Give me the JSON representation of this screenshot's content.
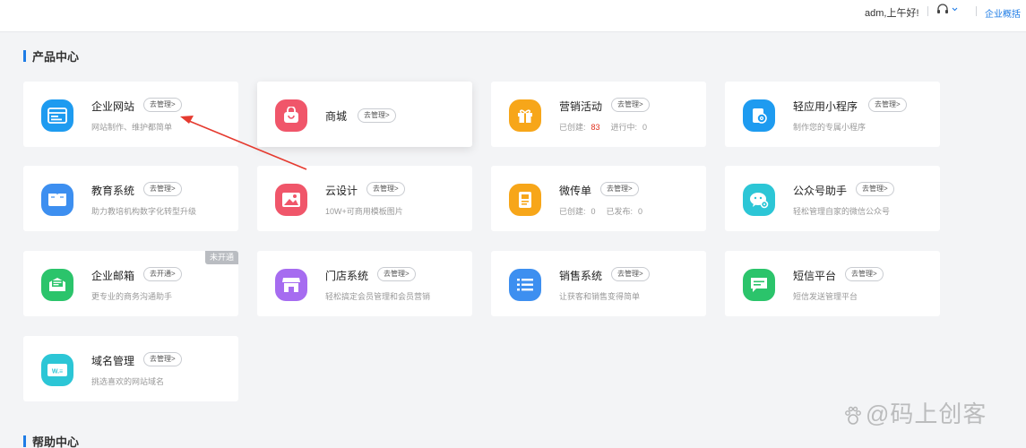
{
  "header": {
    "greeting": "adm,上午好!",
    "nav_link": "企业概括"
  },
  "sections": {
    "product_center": "产品中心",
    "help_center": "帮助中心"
  },
  "products": [
    {
      "name": "企业网站",
      "action": "去管理>",
      "desc": "网站制作、维护都简单",
      "icon": "browser-window-icon",
      "color": "#1e9bf0"
    },
    {
      "name": "商城",
      "action": "去管理>",
      "desc": "",
      "icon": "shopping-bag-icon",
      "color": "#f0566a"
    },
    {
      "name": "营销活动",
      "action": "去管理>",
      "stats": {
        "created_label": "已创建:",
        "created_value": "83",
        "running_label": "进行中:",
        "running_value": "0"
      },
      "icon": "gift-box-icon",
      "color": "#f7a619"
    },
    {
      "name": "轻应用小程序",
      "action": "去管理>",
      "desc": "制作您的专属小程序",
      "icon": "mini-program-icon",
      "color": "#1e9bf0"
    },
    {
      "name": "教育系统",
      "action": "去管理>",
      "desc": "助力教培机构数字化转型升级",
      "icon": "open-book-icon",
      "color": "#3d8ff0"
    },
    {
      "name": "云设计",
      "action": "去管理>",
      "desc": "10W+可商用模板图片",
      "icon": "image-picture-icon",
      "color": "#f0566a"
    },
    {
      "name": "微传单",
      "action": "去管理>",
      "stats": {
        "created_label": "已创建:",
        "created_value": "0",
        "published_label": "已发布:",
        "published_value": "0"
      },
      "icon": "flyer-icon",
      "color": "#f7a619"
    },
    {
      "name": "公众号助手",
      "action": "去管理>",
      "desc": "轻松管理自家的微信公众号",
      "icon": "wechat-gear-icon",
      "color": "#2cc6d6"
    },
    {
      "name": "企业邮箱",
      "action": "去开通>",
      "desc": "更专业的商务沟通助手",
      "badge": "未开通",
      "icon": "mailbox-icon",
      "color": "#2bc46b"
    },
    {
      "name": "门店系统",
      "action": "去管理>",
      "desc": "轻松搞定会员管理和会员营销",
      "icon": "storefront-icon",
      "color": "#a66cf0"
    },
    {
      "name": "销售系统",
      "action": "去管理>",
      "desc": "让获客和销售变得简单",
      "icon": "list-icon",
      "color": "#3d8ff0"
    },
    {
      "name": "短信平台",
      "action": "去管理>",
      "desc": "短信发送管理平台",
      "icon": "sms-message-icon",
      "color": "#2bc46b"
    },
    {
      "name": "域名管理",
      "action": "去管理>",
      "desc": "挑选喜欢的网站域名",
      "icon": "domain-www-icon",
      "color": "#2cc6d6"
    }
  ],
  "annotation": {
    "color": "#e53a2f"
  },
  "watermark": "@码上创客"
}
